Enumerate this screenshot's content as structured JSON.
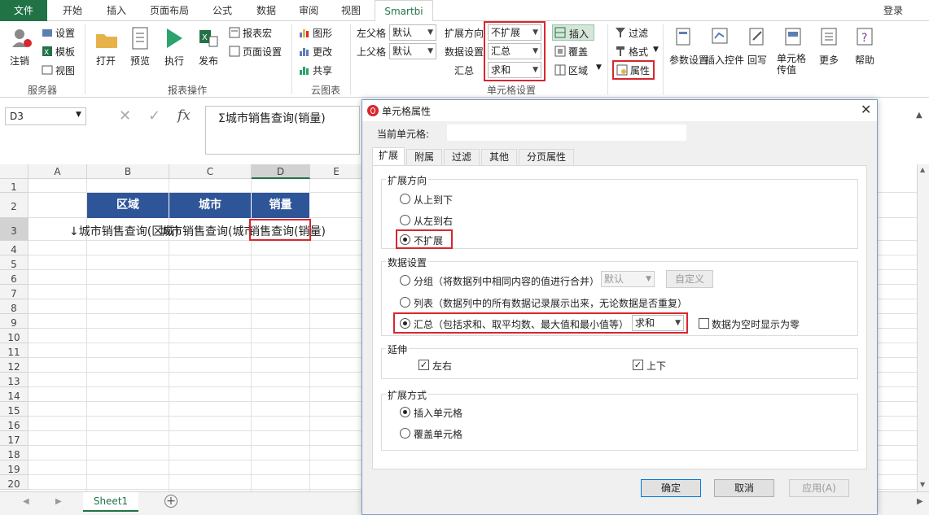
{
  "ribbon_tabs": [
    "文件",
    "开始",
    "插入",
    "页面布局",
    "公式",
    "数据",
    "审阅",
    "视图",
    "Smartbi"
  ],
  "login": "登录",
  "groups": {
    "server": {
      "label": "服务器",
      "logout": "注销",
      "settings": "设置",
      "template": "模板",
      "view": "视图"
    },
    "report_ops": {
      "label": "报表操作",
      "open": "打开",
      "preview": "预览",
      "execute": "执行",
      "publish": "发布",
      "macro": "报表宏",
      "page_setup": "页面设置"
    },
    "cloud_chart": {
      "label": "云图表",
      "chart": "图形",
      "update": "更改",
      "share": "共享"
    },
    "cell_settings": {
      "label": "单元格设置",
      "left_parent": "左父格",
      "left_parent_value": "默认",
      "top_parent": "上父格",
      "top_parent_value": "默认",
      "expand_dir": "扩展方向",
      "expand_dir_value": "不扩展",
      "data_setting": "数据设置",
      "data_setting_value": "汇总",
      "summary": "汇总",
      "summary_value": "求和",
      "insert": "插入",
      "cover": "覆盖",
      "area": "区域"
    },
    "filter": "过滤",
    "format": "格式",
    "property": "属性",
    "param_setting": "参数设置",
    "insert_control": "插入控件",
    "write_back": "回写",
    "cell_pass": "单元格传值",
    "more": "更多",
    "help": "帮助"
  },
  "formula_bar": {
    "cell_ref": "D3",
    "fx": "fx",
    "content": "Σ城市销售查询(销量)"
  },
  "columns": [
    "A",
    "B",
    "C",
    "D",
    "E"
  ],
  "rows": [
    "1",
    "2",
    "3",
    "4",
    "5",
    "6",
    "7",
    "8",
    "9",
    "10",
    "11",
    "12",
    "13",
    "14",
    "15",
    "16",
    "17",
    "18",
    "19",
    "20"
  ],
  "cells": {
    "b2": "区域",
    "c2": "城市",
    "d2": "销量",
    "b3": "↓城市销售查询(区域)",
    "c3": "城市销售查询(城市)",
    "d3": "销售查询(销量)"
  },
  "sheet_tab": "Sheet1",
  "dialog": {
    "title": "单元格属性",
    "current_cell_label": "当前单元格:",
    "current_cell_value": "",
    "tabs": [
      "扩展",
      "附属",
      "过滤",
      "其他",
      "分页属性"
    ],
    "expand_direction": {
      "legend": "扩展方向",
      "top_down": "从上到下",
      "left_right": "从左到右",
      "none": "不扩展"
    },
    "data_setting": {
      "legend": "数据设置",
      "group": "分组（将数据列中相同内容的值进行合并）",
      "group_select": "默认",
      "custom": "自定义",
      "list": "列表（数据列中的所有数据记录展示出来，无论数据是否重复）",
      "summary": "汇总（包括求和、取平均数、最大值和最小值等）",
      "summary_select": "求和",
      "zero_if_empty": "数据为空时显示为零"
    },
    "extend": {
      "legend": "延伸",
      "lr": "左右",
      "ud": "上下"
    },
    "expand_method": {
      "legend": "扩展方式",
      "insert": "插入单元格",
      "cover": "覆盖单元格"
    },
    "ok": "确定",
    "cancel": "取消",
    "apply": "应用(A)"
  },
  "colors": {
    "excel_green": "#217346",
    "header_blue": "#2e5597",
    "highlight_red": "#d9262e"
  }
}
